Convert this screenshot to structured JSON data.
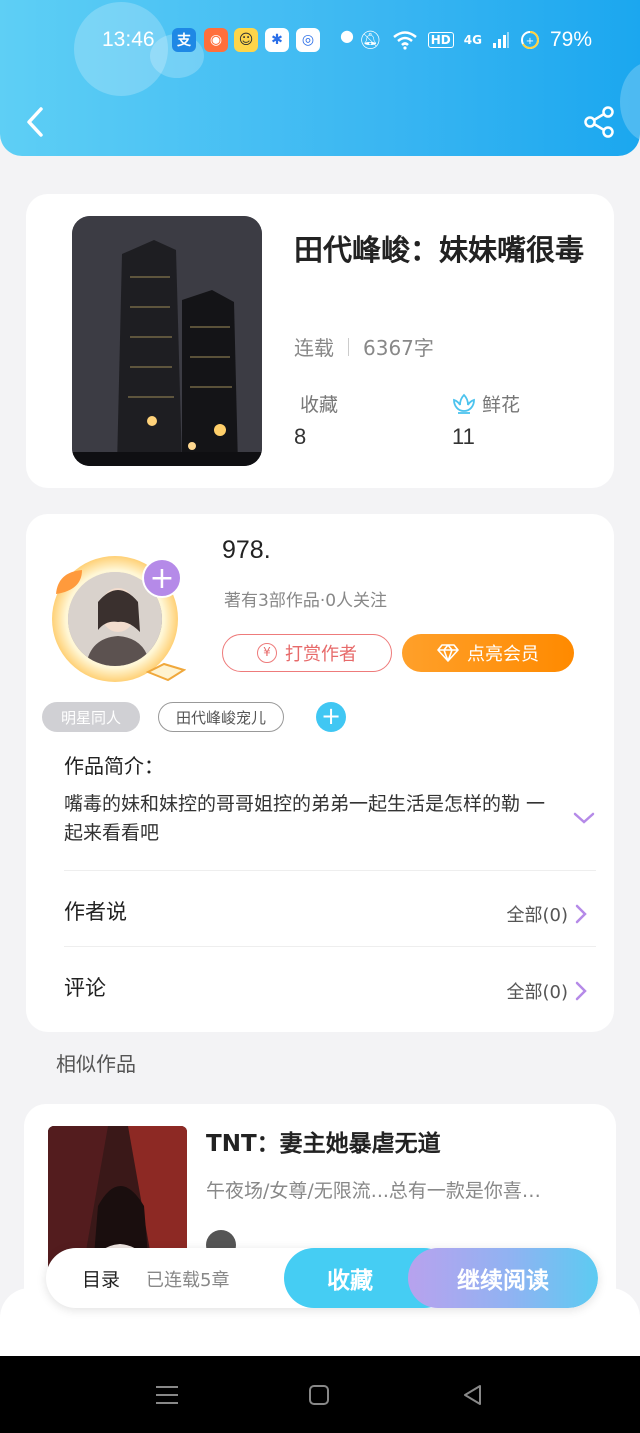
{
  "status_bar": {
    "time": "13:46",
    "network": "HD",
    "signal": "4G",
    "battery": "79%"
  },
  "header": {
    "back_icon": "chevron-left-icon",
    "share_icon": "share-icon"
  },
  "book": {
    "title": "田代峰峻：妹妹嘴很毒",
    "status": "连载",
    "word_count": "6367字",
    "favorites_label": "收藏",
    "favorites_value": "8",
    "flowers_label": "鲜花",
    "flowers_value": "11"
  },
  "author": {
    "name": "978.",
    "summary": "著有3部作品·0人关注",
    "tip_label": "打赏作者",
    "tip_coin": "¥",
    "vip_label": "点亮会员",
    "tags": [
      "明星同人",
      "田代峰峻宠儿"
    ]
  },
  "intro": {
    "label": "作品简介：",
    "text": "嘴毒的妹和妹控的哥哥姐控的弟弟一起生活是怎样的勒 一起来看看吧"
  },
  "author_says": {
    "label": "作者说",
    "link": "全部(0)"
  },
  "comments": {
    "label": "评论",
    "link": "全部(0)"
  },
  "similar": {
    "section_title": "相似作品",
    "items": [
      {
        "title": "TNT：妻主她暴虐无道",
        "desc": "午夜场/女尊/无限流...总有一款是你喜…"
      }
    ]
  },
  "bottom_bar": {
    "toc_label": "目录",
    "toc_sub": "已连载5章",
    "fav_label": "收藏",
    "read_label": "继续阅读"
  },
  "colors": {
    "header": "#3ab6f2",
    "accent_blue": "#45cdf3",
    "vip_orange": "#ff8a00",
    "tip_red": "#e76a6a",
    "purple": "#b58ae8"
  }
}
